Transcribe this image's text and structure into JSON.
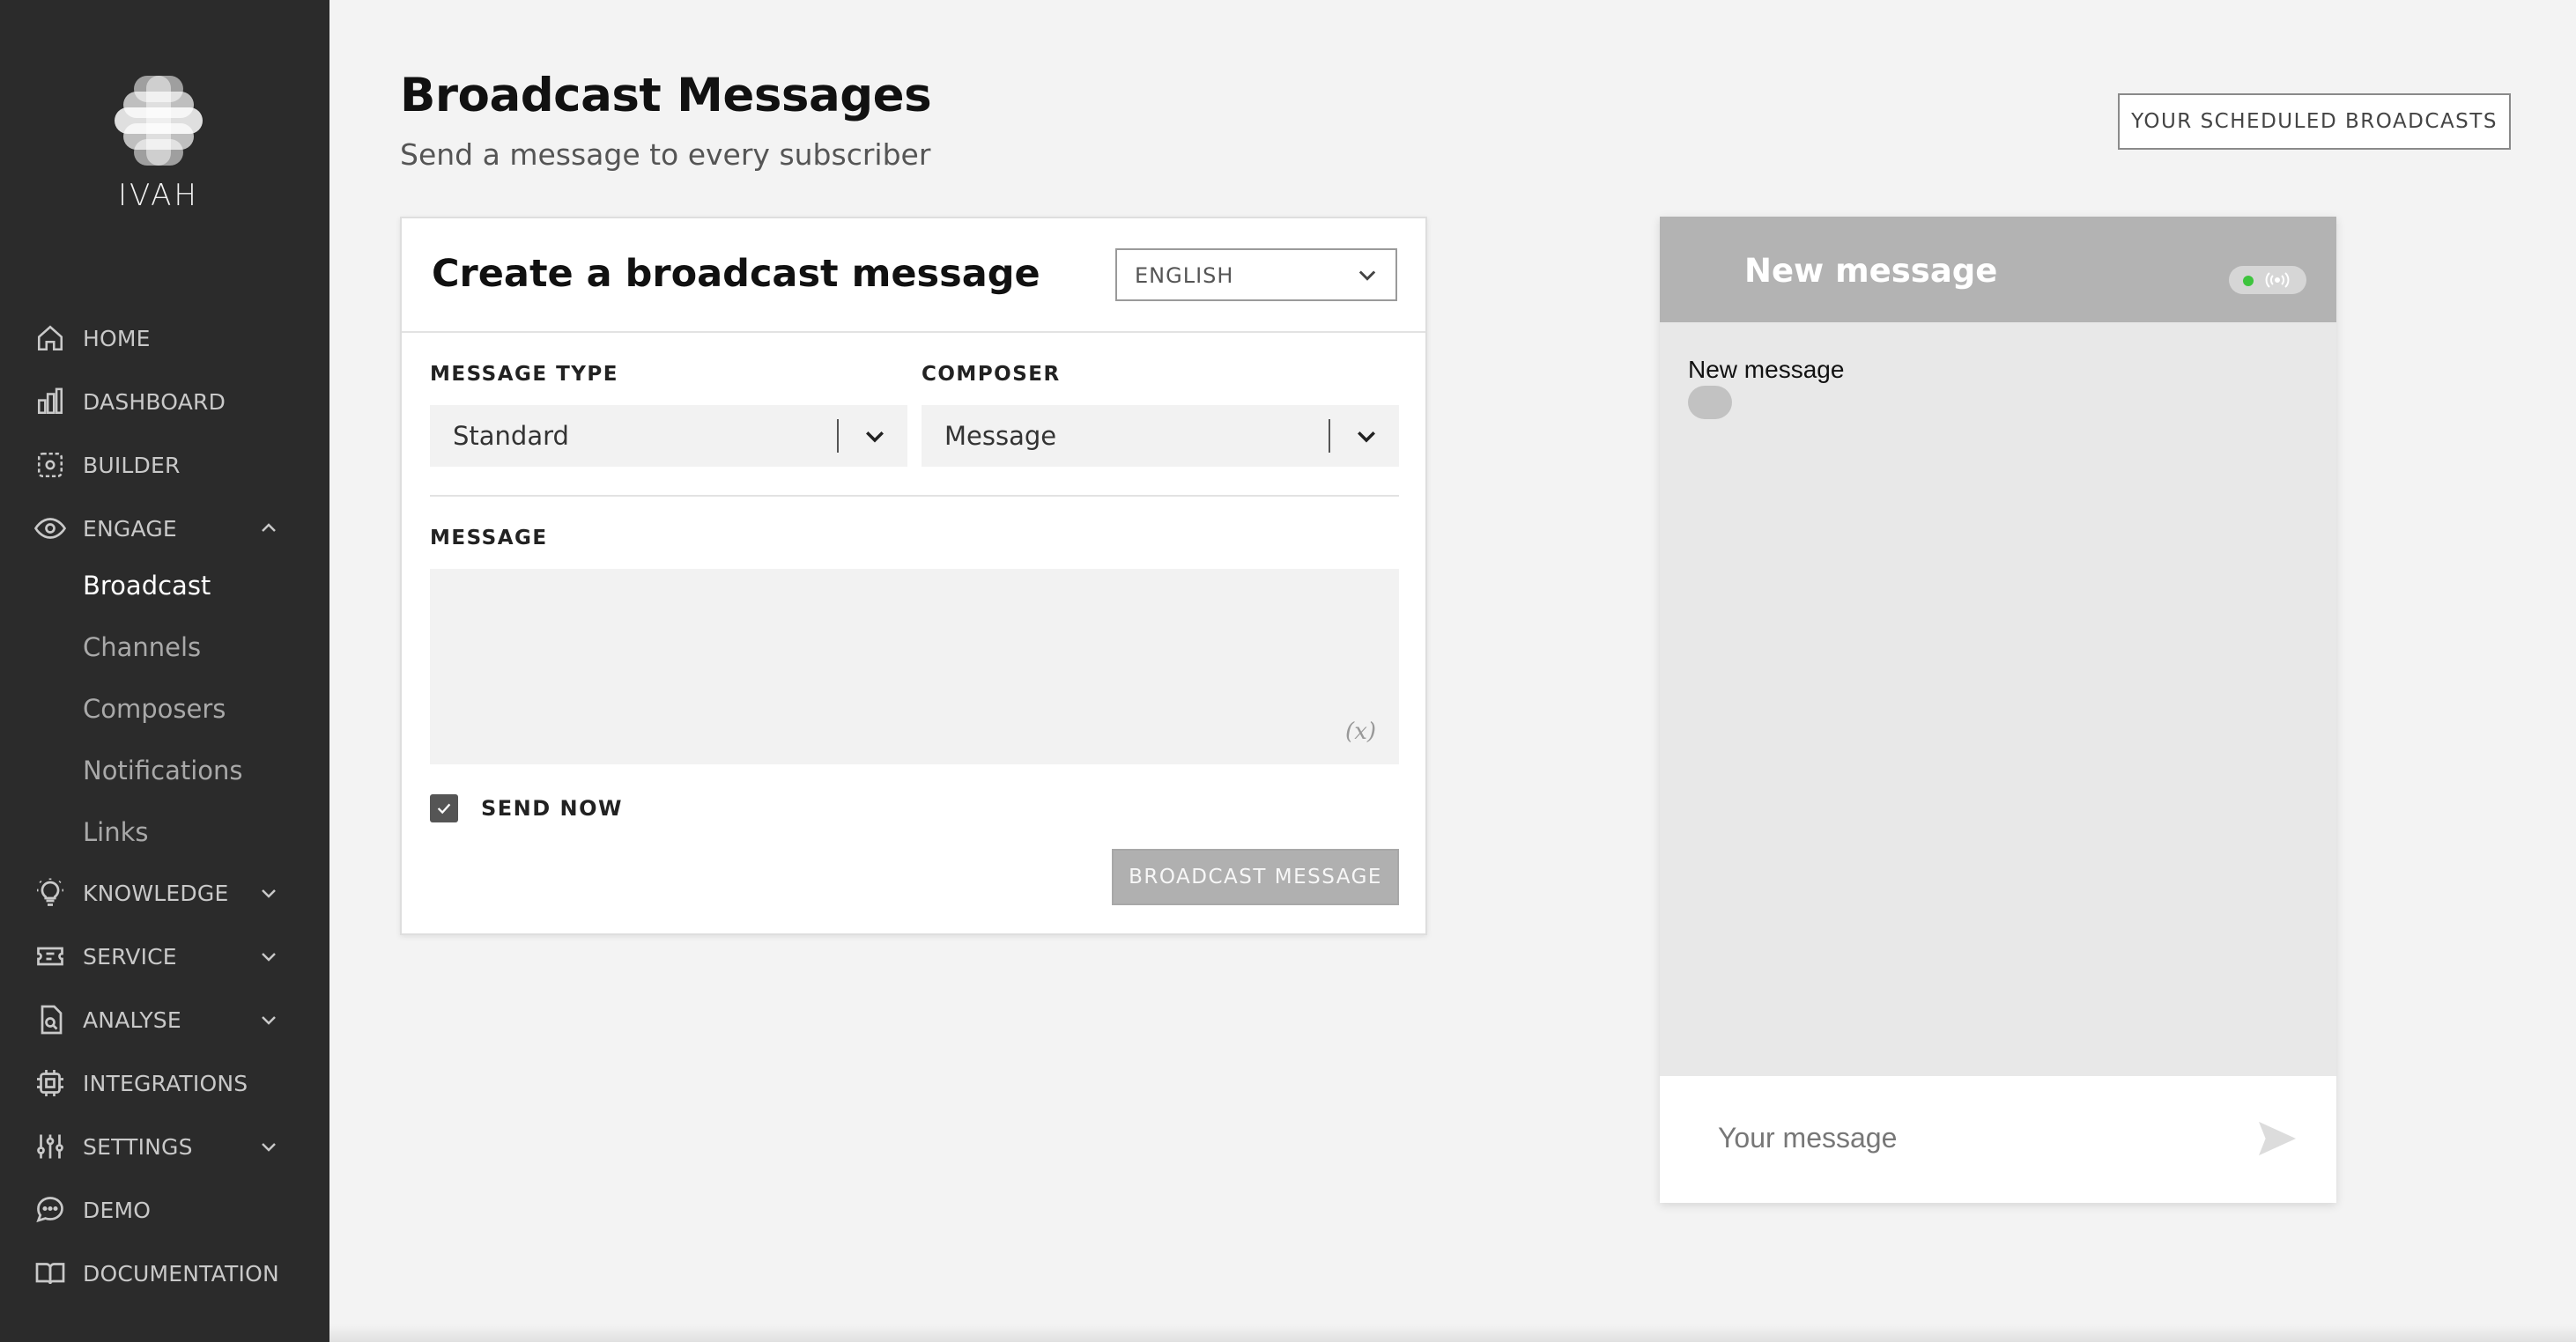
{
  "brand": {
    "name": "IVAH"
  },
  "sidebar": {
    "items": [
      {
        "label": "HOME",
        "icon": "home-icon"
      },
      {
        "label": "DASHBOARD",
        "icon": "bar-chart-icon"
      },
      {
        "label": "BUILDER",
        "icon": "builder-icon"
      },
      {
        "label": "ENGAGE",
        "icon": "eye-icon",
        "expanded": true
      },
      {
        "label": "KNOWLEDGE",
        "icon": "lightbulb-icon"
      },
      {
        "label": "SERVICE",
        "icon": "ticket-icon"
      },
      {
        "label": "ANALYSE",
        "icon": "analyse-icon"
      },
      {
        "label": "INTEGRATIONS",
        "icon": "chip-icon"
      },
      {
        "label": "SETTINGS",
        "icon": "sliders-icon"
      },
      {
        "label": "DEMO",
        "icon": "chat-bubble-icon"
      },
      {
        "label": "DOCUMENTATION",
        "icon": "book-icon"
      }
    ],
    "engage_sub": [
      {
        "label": "Broadcast",
        "active": true
      },
      {
        "label": "Channels"
      },
      {
        "label": "Composers"
      },
      {
        "label": "Notifications"
      },
      {
        "label": "Links"
      }
    ]
  },
  "header": {
    "title": "Broadcast Messages",
    "subtitle": "Send a message to every subscriber",
    "scheduled_button": "YOUR SCHEDULED BROADCASTS"
  },
  "form": {
    "title": "Create a broadcast message",
    "language": "ENGLISH",
    "message_type_label": "MESSAGE TYPE",
    "message_type_value": "Standard",
    "composer_label": "COMPOSER",
    "composer_value": "Message",
    "message_label": "MESSAGE",
    "message_value": "",
    "variable_symbol": "(x)",
    "send_now_label": "SEND NOW",
    "send_now_checked": true,
    "submit_label": "BROADCAST MESSAGE"
  },
  "preview": {
    "title": "New message",
    "status_color": "#3ec43e",
    "message_text": "New message",
    "input_placeholder": "Your message"
  },
  "colors": {
    "sidebar_bg": "#2b2b2b",
    "page_bg": "#f3f3f3",
    "preview_header": "#b3b3b3",
    "button_disabled": "#b0b0b0"
  }
}
